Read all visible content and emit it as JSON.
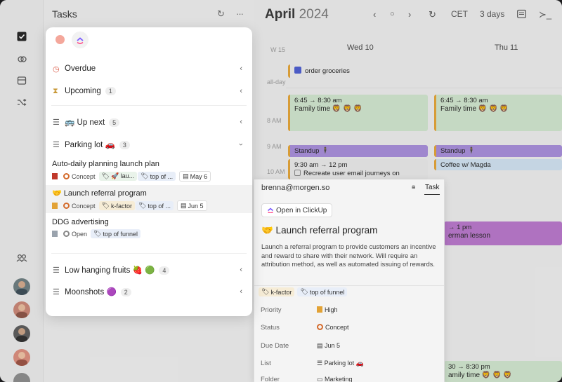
{
  "tasks_panel": {
    "title": "Tasks",
    "refresh_icon": "↻",
    "more_icon": "···"
  },
  "popover": {
    "sections": [
      {
        "label": "Overdue",
        "icon": "clock-icon"
      },
      {
        "label": "Upcoming",
        "count": "1",
        "icon": "hourglass-icon"
      },
      {
        "label": "🚌 Up next",
        "count": "5",
        "icon": "list-icon"
      },
      {
        "label": "Parking lot 🚗",
        "count": "3",
        "icon": "list-icon"
      },
      {
        "label": "Low hanging fruits 🍓 🟢",
        "count": "4",
        "icon": "list-icon"
      },
      {
        "label": "Moonshots 🟣",
        "count": "2",
        "icon": "list-icon"
      }
    ],
    "task_items": [
      {
        "title": "Auto-daily planning launch plan",
        "status": "Concept",
        "tags": [
          "🚀 lau...",
          "top of ..."
        ],
        "date": "May 6"
      },
      {
        "title": "🤝 Launch referral program",
        "status": "Concept",
        "tags": [
          "k-factor",
          "top of ..."
        ],
        "date": "Jun 5"
      },
      {
        "title": "DDG advertising",
        "status": "Open",
        "tags": [
          "top of funnel"
        ]
      }
    ]
  },
  "calendar": {
    "month": "April",
    "year": "2024",
    "timezone": "CET",
    "range": "3 days",
    "week": "W 15",
    "days": [
      "Wed 10",
      "Thu 11"
    ],
    "allday_label": "all-day",
    "times": [
      "8 AM",
      "9 AM",
      "10 AM"
    ],
    "events": {
      "groceries": "order groceries",
      "family_time_time": "6:45 → 8:30 am",
      "family_time_title": "Family time 🦁 🦁 🦁",
      "standup": "Standup 🕴",
      "recreate_time": "9:30 am → 12 pm",
      "recreate_title": "Recreate user email journeys on",
      "coffee": "Coffee w/ Magda",
      "german_time": "→ 1 pm",
      "german_title": "erman lesson",
      "family_bottom_time": "30 → 8:30 pm",
      "family_bottom_title": "amily time 🦁 🦁 🦁"
    }
  },
  "detail": {
    "email": "brenna@morgen.so",
    "tab": "Task",
    "open_button": "Open in ClickUp",
    "title": "🤝 Launch referral program",
    "description": "Launch a referral program to provide customers an incentive and reward to share with their network. Will require an attribution method, as well as automated issuing of rewards.",
    "tags": [
      "k-factor",
      "top of funnel"
    ],
    "fields": [
      {
        "label": "Priority",
        "value": "High"
      },
      {
        "label": "Status",
        "value": "Concept"
      },
      {
        "label": "Due Date",
        "value": "Jun 5"
      },
      {
        "label": "List",
        "value": "Parking lot 🚗"
      },
      {
        "label": "Folder",
        "value": "Marketing"
      }
    ]
  },
  "colors": {
    "accent_orange": "#e2a235",
    "standup_purple": "#a58bd8",
    "flag_red": "#c0392b",
    "status_orange": "#d46b2c"
  }
}
